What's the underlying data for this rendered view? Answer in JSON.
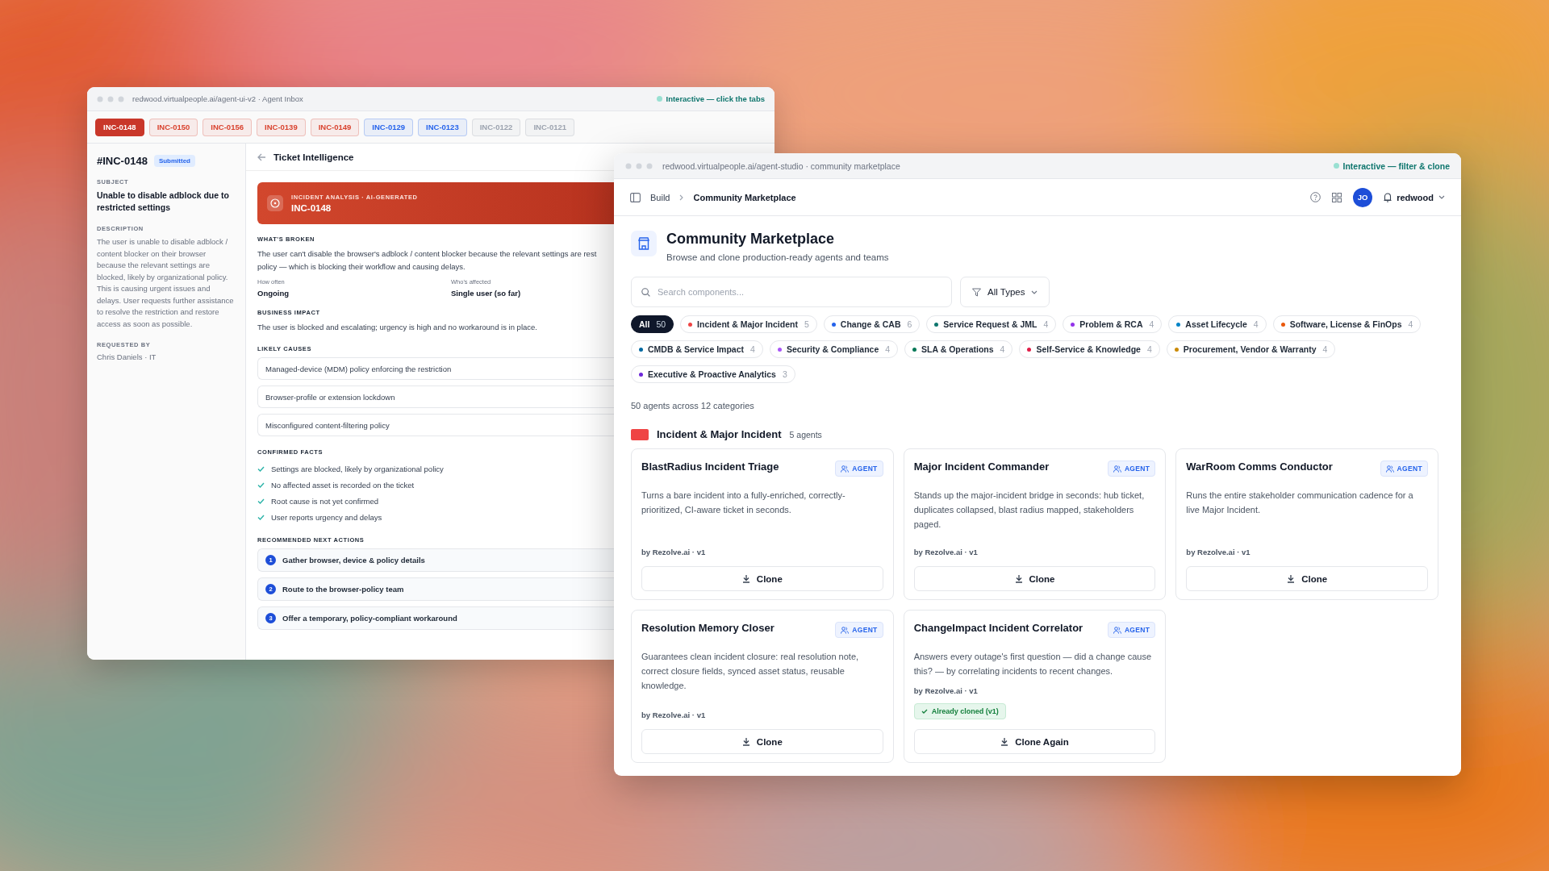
{
  "inbox_window": {
    "url": "redwood.virtualpeople.ai/agent-ui-v2 · Agent Inbox",
    "hint": "Interactive — click the tabs",
    "tickets": [
      {
        "label": "INC-0148",
        "color": "#c9372a",
        "selected": true
      },
      {
        "label": "INC-0150",
        "color": "#d9432f",
        "selected": false
      },
      {
        "label": "INC-0156",
        "color": "#d9432f",
        "selected": false
      },
      {
        "label": "INC-0139",
        "color": "#d9432f",
        "selected": false
      },
      {
        "label": "INC-0149",
        "color": "#d9432f",
        "selected": false
      },
      {
        "label": "INC-0129",
        "color": "#2563eb",
        "selected": false
      },
      {
        "label": "INC-0123",
        "color": "#2563eb",
        "selected": false
      },
      {
        "label": "INC-0122",
        "color": "#9ca3af",
        "selected": false
      },
      {
        "label": "INC-0121",
        "color": "#9ca3af",
        "selected": false
      }
    ],
    "ticket": {
      "id": "#INC-0148",
      "status": "Submitted",
      "subject_label": "SUBJECT",
      "subject": "Unable to disable adblock due to restricted settings",
      "description_label": "DESCRIPTION",
      "description": "The user is unable to disable adblock / content blocker on their browser because the relevant settings are blocked, likely by organizational policy. This is causing urgent issues and delays. User requests further assistance to resolve the restriction and restore access as soon as possible.",
      "requested_by_label": "REQUESTED BY",
      "requested_by": "Chris Daniels · IT"
    },
    "panel": {
      "title": "Ticket Intelligence",
      "banner": {
        "eyebrow": "INCIDENT ANALYSIS · AI-GENERATED",
        "title": "INC-0148"
      },
      "whats_broken": {
        "heading": "WHAT'S BROKEN",
        "lines": [
          "The user can't disable the browser's adblock / content blocker because the relevant settings are rest",
          "policy — which is blocking their workflow and causing delays."
        ]
      },
      "facts": [
        {
          "label": "How often",
          "value": "Ongoing"
        },
        {
          "label": "Who's affected",
          "value": "Single user (so far)"
        }
      ],
      "business_impact": {
        "heading": "BUSINESS IMPACT",
        "text": "The user is blocked and escalating; urgency is high and no workaround is in place."
      },
      "likely_causes": {
        "heading": "LIKELY CAUSES",
        "items": [
          "Managed-device (MDM) policy enforcing the restriction",
          "Browser-profile or extension lockdown",
          "Misconfigured content-filtering policy"
        ]
      },
      "confirmed_facts": {
        "heading": "CONFIRMED FACTS",
        "items": [
          "Settings are blocked, likely by organizational policy",
          "No affected asset is recorded on the ticket",
          "Root cause is not yet confirmed",
          "User reports urgency and delays"
        ]
      },
      "next_actions": {
        "heading": "RECOMMENDED NEXT ACTIONS",
        "items": [
          {
            "number": "1",
            "text": "Gather browser, device & policy details"
          },
          {
            "number": "2",
            "text": "Route to the browser-policy team"
          },
          {
            "number": "3",
            "text": "Offer a temporary, policy-compliant workaround"
          }
        ]
      }
    }
  },
  "marketplace_window": {
    "url": "redwood.virtualpeople.ai/agent-studio · community marketplace",
    "hint": "Interactive — filter & clone",
    "breadcrumb": [
      "Build",
      "Community Marketplace"
    ],
    "avatar": "JO",
    "workspace": "redwood",
    "title": "Community Marketplace",
    "subtitle": "Browse and clone production-ready agents and teams",
    "search": {
      "placeholder": "Search components..."
    },
    "type_filter": "All Types",
    "categories": [
      {
        "label": "All",
        "count": "50",
        "selected": true
      },
      {
        "label": "Incident & Major Incident",
        "count": "5",
        "color": "#ef4444",
        "selected": false
      },
      {
        "label": "Change & CAB",
        "count": "6",
        "color": "#2563eb",
        "selected": false
      },
      {
        "label": "Service Request & JML",
        "count": "4",
        "color": "#0f766e",
        "selected": false
      },
      {
        "label": "Problem & RCA",
        "count": "4",
        "color": "#9333ea",
        "selected": false
      },
      {
        "label": "Asset Lifecycle",
        "count": "4",
        "color": "#0284c7",
        "selected": false
      },
      {
        "label": "Software, License & FinOps",
        "count": "4",
        "color": "#ea580c",
        "selected": false
      },
      {
        "label": "CMDB & Service Impact",
        "count": "4",
        "color": "#0369a1",
        "selected": false
      },
      {
        "label": "Security & Compliance",
        "count": "4",
        "color": "#a855f7",
        "selected": false
      },
      {
        "label": "SLA & Operations",
        "count": "4",
        "color": "#047857",
        "selected": false
      },
      {
        "label": "Self-Service & Knowledge",
        "count": "4",
        "color": "#e11d48",
        "selected": false
      },
      {
        "label": "Procurement, Vendor & Warranty",
        "count": "4",
        "color": "#ca8a04",
        "selected": false
      },
      {
        "label": "Executive & Proactive Analytics",
        "count": "3",
        "color": "#6d28d9",
        "selected": false
      }
    ],
    "summary": "50 agents across 12 categories",
    "section": {
      "title": "Incident & Major Incident",
      "count": "5 agents",
      "color": "#ef4444"
    },
    "agents": [
      {
        "name": "BlastRadius Incident Triage",
        "badge": "AGENT",
        "description": "Turns a bare incident into a fully-enriched, correctly-prioritized, CI-aware ticket in seconds.",
        "author": "by Rezolve.ai · v1",
        "cloned": false,
        "button": "Clone"
      },
      {
        "name": "Major Incident Commander",
        "badge": "AGENT",
        "description": "Stands up the major-incident bridge in seconds: hub ticket, duplicates collapsed, blast radius mapped, stakeholders paged.",
        "author": "by Rezolve.ai · v1",
        "cloned": false,
        "button": "Clone"
      },
      {
        "name": "WarRoom Comms Conductor",
        "badge": "AGENT",
        "description": "Runs the entire stakeholder communication cadence for a live Major Incident.",
        "author": "by Rezolve.ai · v1",
        "cloned": false,
        "button": "Clone"
      },
      {
        "name": "Resolution Memory Closer",
        "badge": "AGENT",
        "description": "Guarantees clean incident closure: real resolution note, correct closure fields, synced asset status, reusable knowledge.",
        "author": "by Rezolve.ai · v1",
        "cloned": false,
        "button": "Clone"
      },
      {
        "name": "ChangeImpact Incident Correlator",
        "badge": "AGENT",
        "description": "Answers every outage's first question — did a change cause this? — by correlating incidents to recent changes.",
        "author": "by Rezolve.ai · v1",
        "cloned": true,
        "cloned_label": "Already cloned (v1)",
        "button": "Clone Again"
      }
    ]
  }
}
